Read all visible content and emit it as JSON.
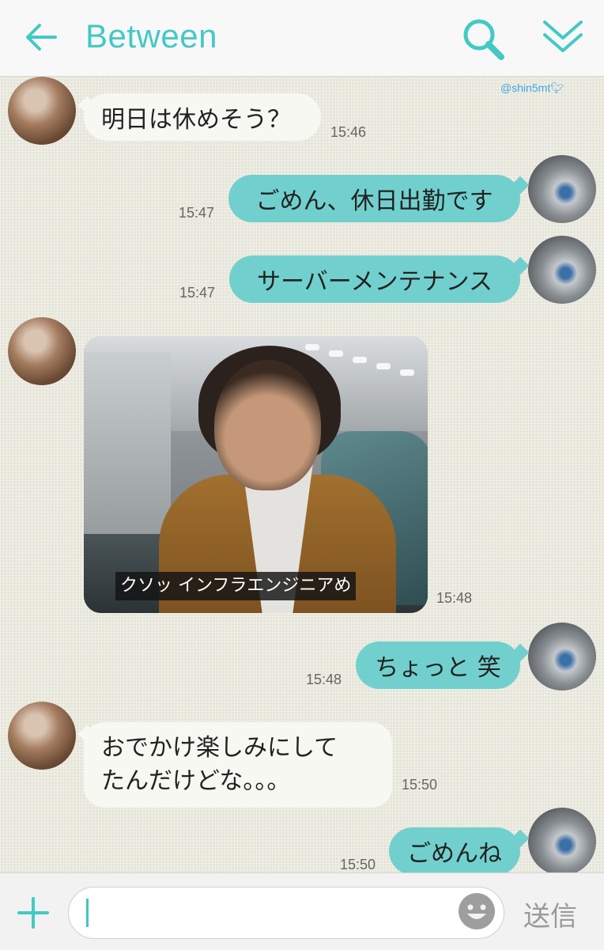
{
  "header": {
    "title": "Between"
  },
  "watermark": "@shin5mt",
  "messages": [
    {
      "side": "in",
      "text": "明日は休めそう？",
      "time": "15:46"
    },
    {
      "side": "out",
      "text": "ごめん、休日出勤です",
      "time": "15:47"
    },
    {
      "side": "out",
      "text": "サーバーメンテナンス",
      "time": "15:47"
    },
    {
      "side": "in",
      "type": "image",
      "caption": "クソッ インフラエンジニアめ",
      "time": "15:48"
    },
    {
      "side": "out",
      "text": "ちょっと 笑",
      "time": "15:48"
    },
    {
      "side": "in",
      "text_line1": "おでかけ楽しみにして",
      "text_line2": "たんだけどな。。。",
      "time": "15:50"
    },
    {
      "side": "out",
      "text": "ごめんね",
      "time": "15:50"
    }
  ],
  "input": {
    "value": "",
    "send_label": "送信"
  },
  "colors": {
    "accent": "#43c9c4",
    "outgoing_bubble": "#71d0cd",
    "incoming_bubble": "#f8f8f3",
    "background": "#e6e5d9"
  },
  "icons": [
    "back-arrow-icon",
    "search-icon",
    "chevron-down-icon",
    "plus-icon",
    "emoji-icon"
  ]
}
